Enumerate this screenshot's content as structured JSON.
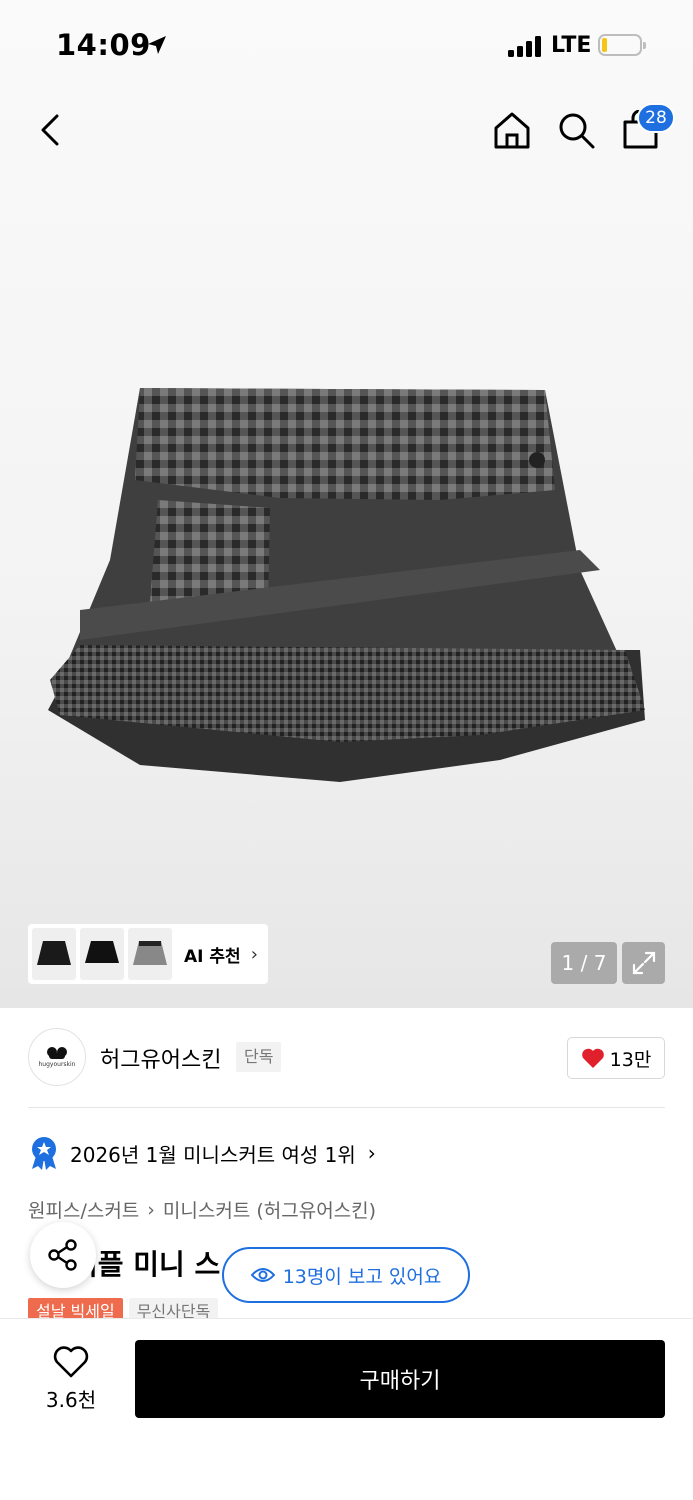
{
  "status_bar": {
    "time": "14:09",
    "network": "LTE"
  },
  "header": {
    "cart_count": "28"
  },
  "gallery": {
    "ai_label": "AI 추천",
    "page_indicator": "1 / 7"
  },
  "brand": {
    "name": "허그유어스킨",
    "logo_text": "hugyourskin",
    "exclusive_tag": "단독",
    "likes": "13만"
  },
  "ranking": {
    "text": "2026년 1월 미니스커트 여성 1위"
  },
  "breadcrumb": {
    "level1": "원피스/스커트",
    "level2": "미니스커트 (허그유어스킨)"
  },
  "product": {
    "title_visible": "러플 미니 스"
  },
  "tags": {
    "sale": "설날 빅세일",
    "exclusive": "무신사단독"
  },
  "viewers": {
    "text": "13명이 보고 있어요"
  },
  "bottom": {
    "wish_count": "3.6천",
    "buy_label": "구매하기"
  },
  "colors": {
    "accent": "#1e6fe0",
    "sale": "#ee6b4d",
    "heart": "#e0202a"
  }
}
